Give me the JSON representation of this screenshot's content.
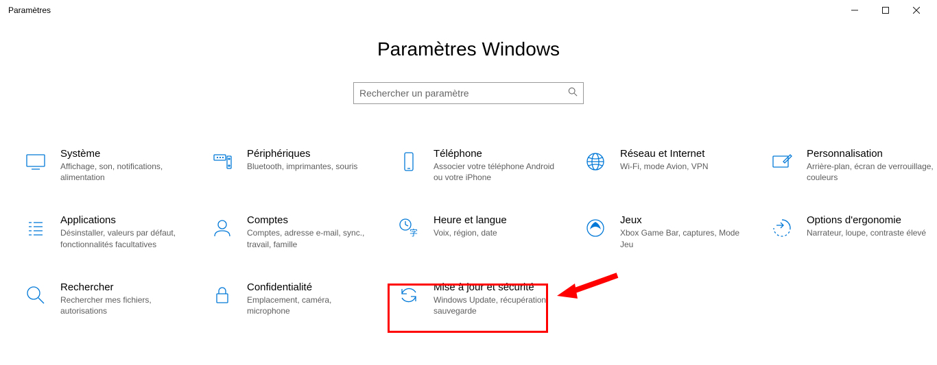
{
  "window": {
    "title": "Paramètres"
  },
  "header": {
    "page_title": "Paramètres Windows"
  },
  "search": {
    "placeholder": "Rechercher un paramètre"
  },
  "tiles": {
    "system": {
      "title": "Système",
      "desc": "Affichage, son, notifications, alimentation"
    },
    "devices": {
      "title": "Périphériques",
      "desc": "Bluetooth, imprimantes, souris"
    },
    "phone": {
      "title": "Téléphone",
      "desc": "Associer votre téléphone Android ou votre iPhone"
    },
    "network": {
      "title": "Réseau et Internet",
      "desc": "Wi-Fi, mode Avion, VPN"
    },
    "personalization": {
      "title": "Personnalisation",
      "desc": "Arrière-plan, écran de verrouillage, couleurs"
    },
    "apps": {
      "title": "Applications",
      "desc": "Désinstaller, valeurs par défaut, fonctionnalités facultatives"
    },
    "accounts": {
      "title": "Comptes",
      "desc": "Comptes, adresse e-mail, sync., travail, famille"
    },
    "time": {
      "title": "Heure et langue",
      "desc": "Voix, région, date"
    },
    "gaming": {
      "title": "Jeux",
      "desc": "Xbox Game Bar, captures, Mode Jeu"
    },
    "ease": {
      "title": "Options d'ergonomie",
      "desc": "Narrateur, loupe, contraste élevé"
    },
    "searchtile": {
      "title": "Rechercher",
      "desc": "Rechercher mes fichiers, autorisations"
    },
    "privacy": {
      "title": "Confidentialité",
      "desc": "Emplacement, caméra, microphone"
    },
    "update": {
      "title": "Mise à jour et sécurité",
      "desc": "Windows Update, récupération, sauvegarde"
    }
  },
  "annotation": {
    "highlight_target": "update"
  }
}
